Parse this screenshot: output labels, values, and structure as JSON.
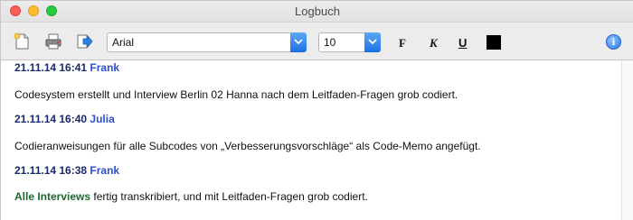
{
  "window": {
    "title": "Logbuch"
  },
  "toolbar": {
    "font": "Arial",
    "size": "10",
    "bold_label": "F",
    "italic_label": "K",
    "underline_label": "U",
    "text_color": "#000000",
    "info_label": "i"
  },
  "entries": [
    {
      "date": "21.11.14 16:41",
      "user": "Frank",
      "text": "Codesystem erstellt und Interview Berlin 02 Hanna nach dem Leitfaden-Fragen grob codiert."
    },
    {
      "date": "21.11.14 16:40",
      "user": "Julia",
      "text": "Codieranweisungen für alle Subcodes von „Verbesserungsvorschläge“ als Code-Memo angefügt."
    },
    {
      "date": "21.11.14 16:38",
      "user": "Frank",
      "link": "Alle Interviews",
      "text": " fertig transkribiert, und mit Leitfaden-Fragen grob codiert."
    }
  ]
}
